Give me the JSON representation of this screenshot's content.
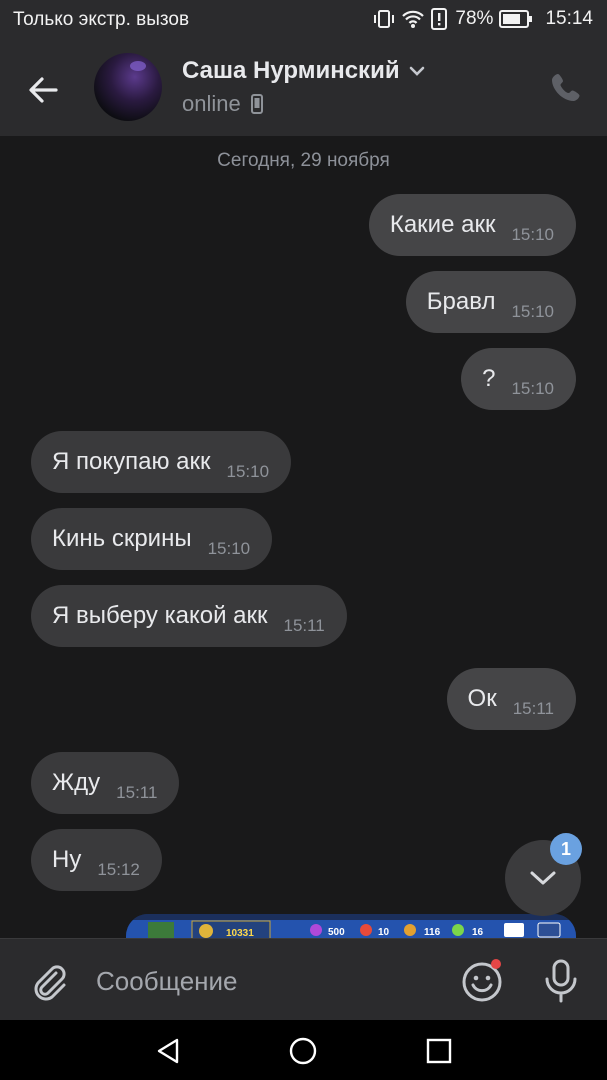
{
  "status_bar": {
    "carrier": "Только экстр. вызов",
    "battery": "78%",
    "time": "15:14"
  },
  "header": {
    "contact_name": "Саша Нурминский",
    "status": "online",
    "icons": {
      "back": "arrow-left-icon",
      "expand": "chevron-down-icon",
      "device": "mobile-device-icon",
      "call": "phone-icon"
    }
  },
  "chat": {
    "date_separator": "Сегодня, 29 ноября",
    "messages": [
      {
        "direction": "out",
        "text": "Какие акк",
        "time": "15:10"
      },
      {
        "direction": "out",
        "text": "Бравл",
        "time": "15:10"
      },
      {
        "direction": "out",
        "text": "?",
        "time": "15:10"
      },
      {
        "direction": "in",
        "text": "Я покупаю акк",
        "time": "15:10"
      },
      {
        "direction": "in",
        "text": "Кинь скрины",
        "time": "15:10"
      },
      {
        "direction": "in",
        "text": "Я выберу какой акк",
        "time": "15:11"
      },
      {
        "direction": "out",
        "text": "Ок",
        "time": "15:11"
      },
      {
        "direction": "in",
        "text": "Жду",
        "time": "15:11"
      },
      {
        "direction": "in",
        "text": "Ну",
        "time": "15:12"
      }
    ],
    "image_preview_values": [
      "10331",
      "500",
      "10",
      "116",
      "16"
    ],
    "unread_count": "1"
  },
  "composer": {
    "placeholder": "Сообщение",
    "icons": {
      "attach": "paperclip-icon",
      "emoji": "emoji-icon",
      "voice": "microphone-icon"
    }
  },
  "colors": {
    "background": "#19191a",
    "bar": "#2b2b2d",
    "incoming_bubble": "#3a3a3c",
    "outgoing_bubble": "#454547",
    "badge": "#6aa1e0",
    "notification_dot": "#e64646"
  }
}
